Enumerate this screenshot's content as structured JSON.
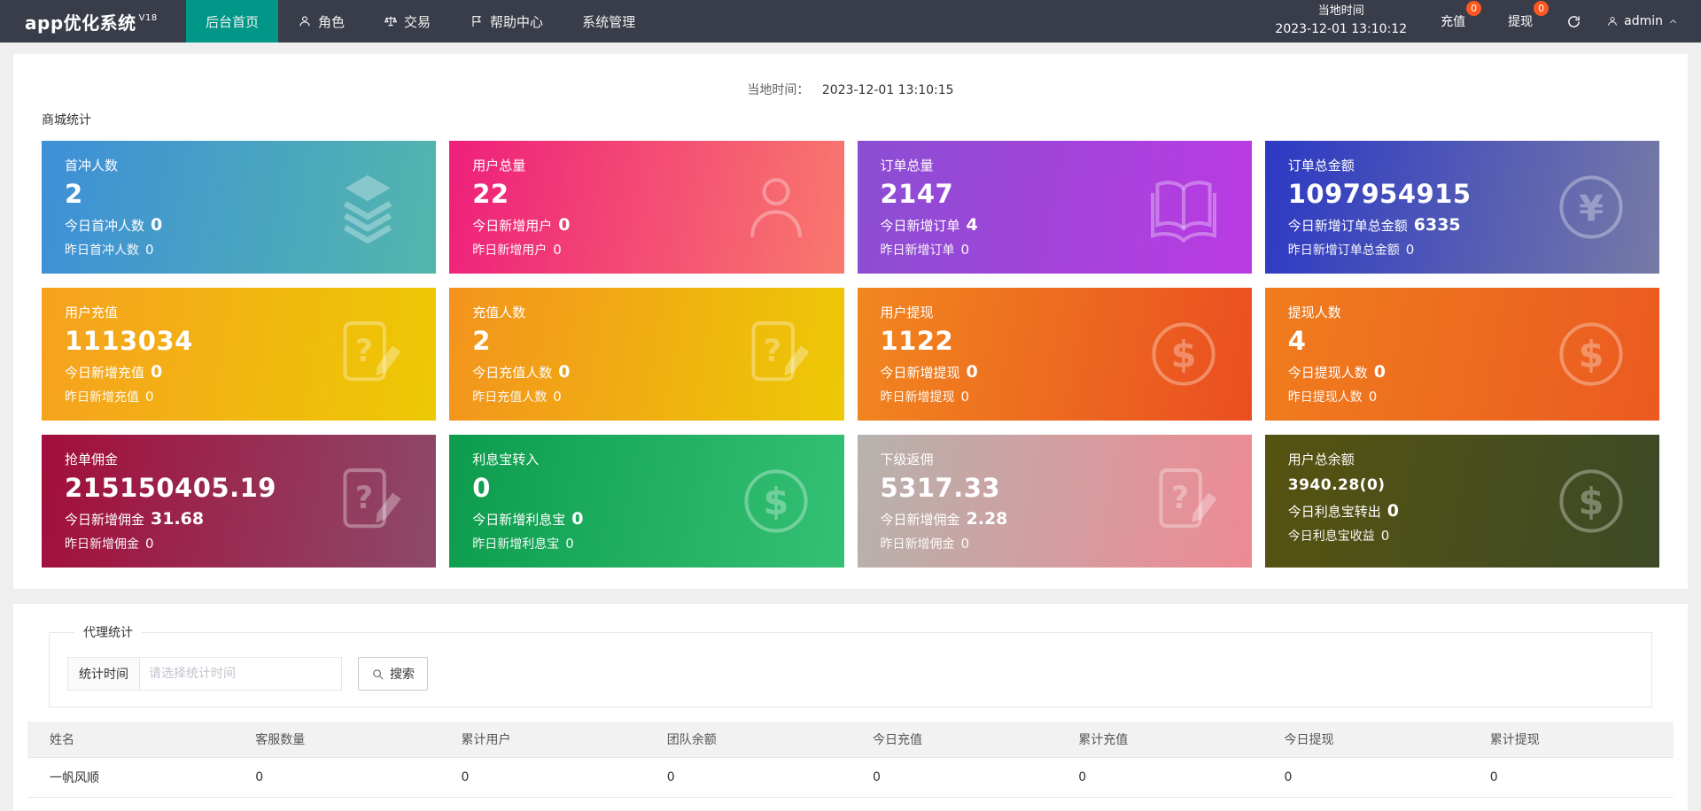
{
  "colors": {
    "header_bg": "#393d49",
    "active_tab": "#009688",
    "badge": "#ff5722"
  },
  "header": {
    "logo_text": "app优化系统",
    "logo_version": "V18",
    "nav": [
      {
        "label": "后台首页"
      },
      {
        "label": "角色"
      },
      {
        "label": "交易"
      },
      {
        "label": "帮助中心"
      },
      {
        "label": "系统管理"
      }
    ],
    "local_time_label": "当地时间",
    "local_time_value": "2023-12-01 13:10:12",
    "recharge_label": "充值",
    "recharge_badge": "0",
    "withdraw_label": "提现",
    "withdraw_badge": "0",
    "user_name": "admin"
  },
  "main": {
    "local_time_label": "当地时间：",
    "local_time_value": "2023-12-01 13:10:15",
    "section_title": "商城统计",
    "cards": [
      {
        "title": "首冲人数",
        "value": "2",
        "line1_label": "今日首冲人数",
        "line1_value": "0",
        "line2_label": "昨日首冲人数",
        "line2_value": "0",
        "icon": "layers-icon",
        "gradient": [
          "#3e8fd8",
          "#53b6ac"
        ]
      },
      {
        "title": "用户总量",
        "value": "22",
        "line1_label": "今日新增用户",
        "line1_value": "0",
        "line2_label": "昨日新增用户",
        "line2_value": "0",
        "icon": "user-icon",
        "gradient": [
          "#ee1f7b",
          "#f9796d"
        ]
      },
      {
        "title": "订单总量",
        "value": "2147",
        "line1_label": "今日新增订单",
        "line1_value": "4",
        "line2_label": "昨日新增订单",
        "line2_value": "0",
        "icon": "book-icon",
        "gradient": [
          "#8a4ed2",
          "#bb3ae3"
        ]
      },
      {
        "title": "订单总金额",
        "value": "1097954915",
        "line1_label": "今日新增订单总金额",
        "line1_value": "6335",
        "line2_label": "昨日新增订单总金额",
        "line2_value": "0",
        "icon": "yen-icon",
        "gradient": [
          "#2c39c4",
          "#767aa6"
        ]
      },
      {
        "title": "用户充值",
        "value": "1113034",
        "line1_label": "今日新增充值",
        "line1_value": "0",
        "line2_label": "昨日新增充值",
        "line2_value": "0",
        "icon": "note-edit-icon",
        "gradient": [
          "#f6a11f",
          "#edc903"
        ]
      },
      {
        "title": "充值人数",
        "value": "2",
        "line1_label": "今日充值人数",
        "line1_value": "0",
        "line2_label": "昨日充值人数",
        "line2_value": "0",
        "icon": "note-edit-icon",
        "gradient": [
          "#f3931e",
          "#edc905"
        ]
      },
      {
        "title": "用户提现",
        "value": "1122",
        "line1_label": "今日新增提现",
        "line1_value": "0",
        "line2_label": "昨日新增提现",
        "line2_value": "0",
        "icon": "dollar-icon",
        "gradient": [
          "#f1871f",
          "#ea4e20"
        ]
      },
      {
        "title": "提现人数",
        "value": "4",
        "line1_label": "今日提现人数",
        "line1_value": "0",
        "line2_label": "昨日提现人数",
        "line2_value": "0",
        "icon": "dollar-icon",
        "gradient": [
          "#f07d1e",
          "#eb5a20"
        ]
      },
      {
        "title": "抢单佣金",
        "value": "215150405.19",
        "line1_label": "今日新增佣金",
        "line1_value": "31.68",
        "line2_label": "昨日新增佣金",
        "line2_value": "0",
        "icon": "note-edit-icon",
        "gradient": [
          "#a30e3b",
          "#8d4a69"
        ]
      },
      {
        "title": "利息宝转入",
        "value": "0",
        "line1_label": "今日新增利息宝",
        "line1_value": "0",
        "line2_label": "昨日新增利息宝",
        "line2_value": "0",
        "icon": "dollar-icon",
        "gradient": [
          "#0d9c4d",
          "#35c175"
        ]
      },
      {
        "title": "下级返佣",
        "value": "5317.33",
        "line1_label": "今日新增佣金",
        "line1_value": "2.28",
        "line2_label": "昨日新增佣金",
        "line2_value": "0",
        "icon": "note-edit-icon",
        "gradient": [
          "#b6b2ad",
          "#ee8a93"
        ]
      },
      {
        "title": "用户总余额",
        "value": "3940.28(0)",
        "line1_label": "今日利息宝转出",
        "line1_value": "0",
        "line2_label": "今日利息宝收益",
        "line2_value": "0",
        "icon": "dollar-icon",
        "gradient": [
          "#565310",
          "#3d4a27"
        ]
      }
    ]
  },
  "agent": {
    "legend": "代理统计",
    "time_label": "统计时间",
    "time_placeholder": "请选择统计时间",
    "search_label": "搜索",
    "table": {
      "headers": [
        "姓名",
        "客服数量",
        "累计用户",
        "团队余额",
        "今日充值",
        "累计充值",
        "今日提现",
        "累计提现"
      ],
      "rows": [
        [
          "一帆风顺",
          "0",
          "0",
          "0",
          "0",
          "0",
          "0",
          "0"
        ]
      ]
    }
  }
}
